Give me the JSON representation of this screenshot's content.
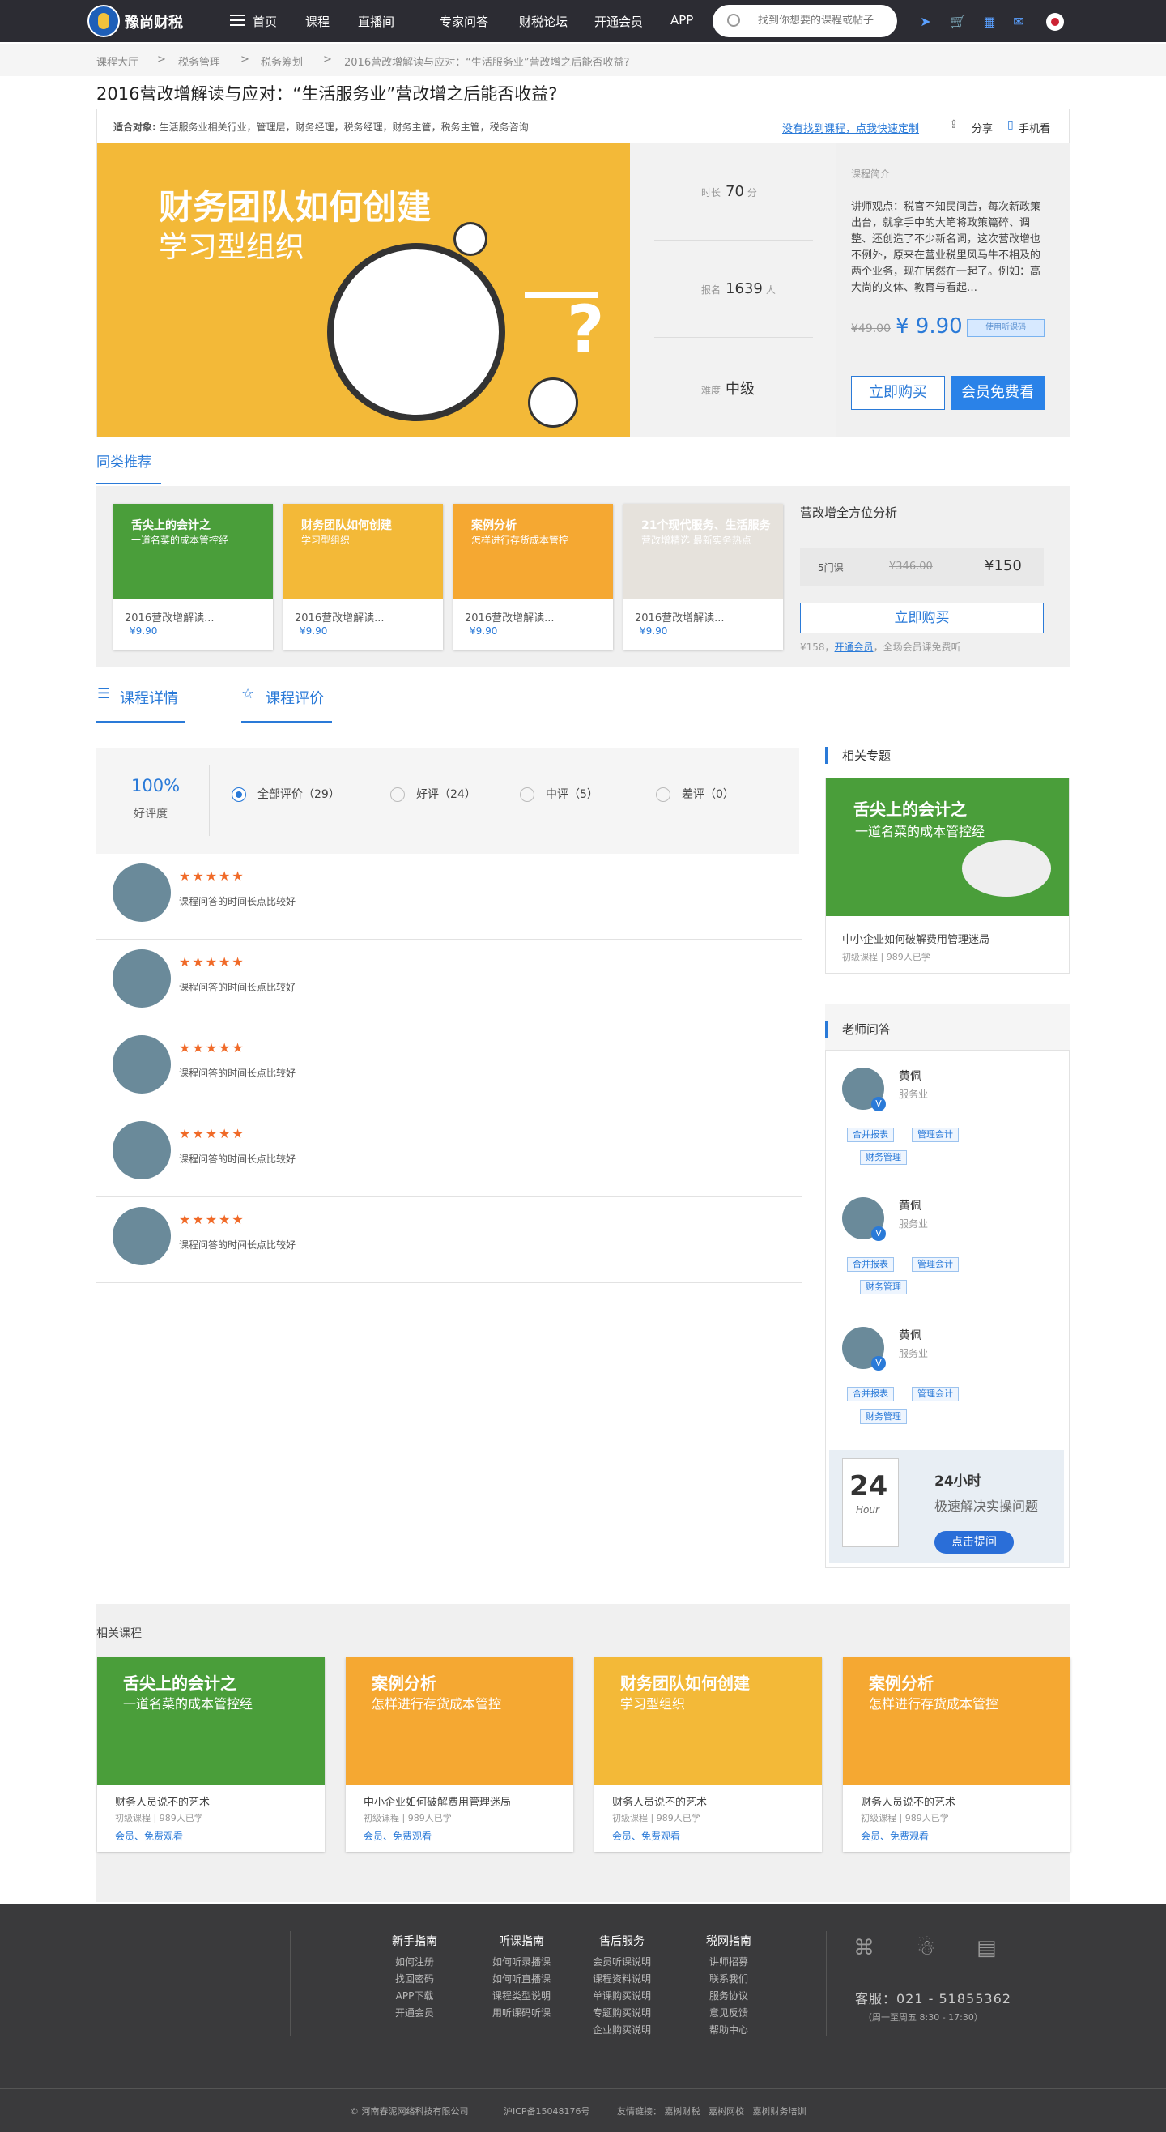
{
  "header": {
    "logo_text": "豫尚财税",
    "nav": [
      "首页",
      "课程",
      "直播间",
      "专家问答",
      "财税论坛",
      "开通会员",
      "APP"
    ],
    "search_placeholder": "找到你想要的课程或帖子"
  },
  "breadcrumb": [
    "课程大厅",
    ">",
    "税务管理",
    ">",
    "税务筹划",
    ">",
    "2016营改增解读与应对：“生活服务业”营改增之后能否收益?"
  ],
  "course": {
    "title": "2016营改增解读与应对：“生活服务业”营改增之后能否收益?",
    "fit_label": "适合对象:",
    "fit_text": "生活服务业相关行业，管理层，财务经理，税务经理，财务主管，税务主管，税务咨询",
    "custom_link": "没有找到课程，点我快速定制",
    "share": "分享",
    "mobile": "手机看",
    "banner_title": "财务团队如何创建",
    "banner_sub": "学习型组织",
    "duration_label": "时长",
    "duration": "70",
    "duration_unit": "分",
    "enroll_label": "报名",
    "enroll": "1639",
    "enroll_unit": "人",
    "level_label": "难度",
    "level": "中级",
    "intro_label": "课程简介",
    "intro": "讲师观点：税官不知民间苦，每次新政策出台，就拿手中的大笔将政策篇碎、调整、还创造了不少新名词，这次营改增也不例外，原来在营业税里风马牛不相及的两个业务，现在居然在一起了。例如：高大尚的文体、教育与看起…",
    "price_old": "¥49.00",
    "price_new": "¥ 9.90",
    "vip_tag": "使用听课码",
    "buy": "立即购买",
    "vip_free": "会员免费看"
  },
  "similar": {
    "title": "同类推荐",
    "cards": [
      {
        "img_title": "舌尖上的会计之",
        "img_sub": "一道名菜的成本管控经",
        "title": "2016营改增解读...",
        "price": "¥9.90",
        "color": "#4a9e3a"
      },
      {
        "img_title": "财务团队如何创建",
        "img_sub": "学习型组织",
        "title": "2016营改增解读...",
        "price": "¥9.90",
        "color": "#f3b938"
      },
      {
        "img_title": "案例分析",
        "img_sub": "怎样进行存货成本管控",
        "title": "2016营改增解读...",
        "price": "¥9.90",
        "color": "#f5a832"
      },
      {
        "img_title": "21个现代服务、生活服务",
        "img_sub": "营改增精选 最新实务热点",
        "title": "2016营改增解读...",
        "price": "¥9.90",
        "color": "#e6e2dc"
      }
    ],
    "bundle_title": "营改增全方位分析",
    "bundle_count": "5门课",
    "bundle_old": "¥346.00",
    "bundle_price": "¥150",
    "bundle_buy": "立即购买",
    "bundle_note_a": "¥158，",
    "bundle_note_link": "开通会员",
    "bundle_note_b": "，全场会员课免费听"
  },
  "tabs": [
    "课程详情",
    "课程评价"
  ],
  "rating": {
    "pct": "100%",
    "pct_label": "好评度",
    "filters": [
      "全部评价（29）",
      "好评（24）",
      "中评（5）",
      "差评（0）"
    ]
  },
  "reviews": [
    {
      "stars": "★★★★★",
      "text": "课程问答的时间长点比较好"
    },
    {
      "stars": "★★★★★",
      "text": "课程问答的时间长点比较好"
    },
    {
      "stars": "★★★★★",
      "text": "课程问答的时间长点比较好"
    },
    {
      "stars": "★★★★★",
      "text": "课程问答的时间长点比较好"
    },
    {
      "stars": "★★★★★",
      "text": "课程问答的时间长点比较好"
    }
  ],
  "sidebar": {
    "topic_h": "相关专题",
    "topic_img_title": "舌尖上的会计之",
    "topic_img_sub": "一道名菜的成本管控经",
    "topic_title": "中小企业如何破解费用管理迷局",
    "topic_meta": "初级课程 | 989人已学",
    "teacher_h": "老师问答",
    "teachers": [
      {
        "name": "黄佩",
        "org": "服务业",
        "tags": [
          "合并报表",
          "管理会计",
          "财务管理"
        ]
      },
      {
        "name": "黄佩",
        "org": "服务业",
        "tags": [
          "合并报表",
          "管理会计",
          "财务管理"
        ]
      },
      {
        "name": "黄佩",
        "org": "服务业",
        "tags": [
          "合并报表",
          "管理会计",
          "财务管理"
        ]
      }
    ],
    "hours_big": "24",
    "hours_word": "Hour",
    "ad_title": "24小时",
    "ad_sub": "极速解决实操问题",
    "ad_btn": "点击提问"
  },
  "related": {
    "title": "相关课程",
    "cards": [
      {
        "img_title": "舌尖上的会计之",
        "img_sub": "一道名菜的成本管控经",
        "title": "财务人员说不的艺术",
        "meta": "初级课程 | 989人已学",
        "free": "会员、免费观看",
        "color": "#4a9e3a"
      },
      {
        "img_title": "案例分析",
        "img_sub": "怎样进行存货成本管控",
        "title": "中小企业如何破解费用管理迷局",
        "meta": "初级课程 | 989人已学",
        "free": "会员、免费观看",
        "color": "#f5a832"
      },
      {
        "img_title": "财务团队如何创建",
        "img_sub": "学习型组织",
        "title": "财务人员说不的艺术",
        "meta": "初级课程 | 989人已学",
        "free": "会员、免费观看",
        "color": "#f3b938"
      },
      {
        "img_title": "案例分析",
        "img_sub": "怎样进行存货成本管控",
        "title": "财务人员说不的艺术",
        "meta": "初级课程 | 989人已学",
        "free": "会员、免费观看",
        "color": "#f5a832"
      }
    ]
  },
  "footer": {
    "cols": [
      {
        "h": "新手指南",
        "items": [
          "如何注册",
          "找回密码",
          "APP下载",
          "开通会员"
        ]
      },
      {
        "h": "听课指南",
        "items": [
          "如何听录播课",
          "如何听直播课",
          "课程类型说明",
          "用听课码听课"
        ]
      },
      {
        "h": "售后服务",
        "items": [
          "会员听课说明",
          "课程资料说明",
          "单课购买说明",
          "专题购买说明",
          "企业购买说明"
        ]
      },
      {
        "h": "税网指南",
        "items": [
          "讲师招募",
          "联系我们",
          "服务协议",
          "意见反馈",
          "帮助中心"
        ]
      }
    ],
    "hotline": "客服：021 - 51855362",
    "hours": "（周一至周五  8:30 - 17:30）",
    "copyright": "© 河南春泥网络科技有限公司",
    "icp": "沪ICP备15048176号",
    "links_label": "友情链接：",
    "links": [
      "嘉树财税",
      "嘉树网校",
      "嘉树财务培训"
    ]
  }
}
